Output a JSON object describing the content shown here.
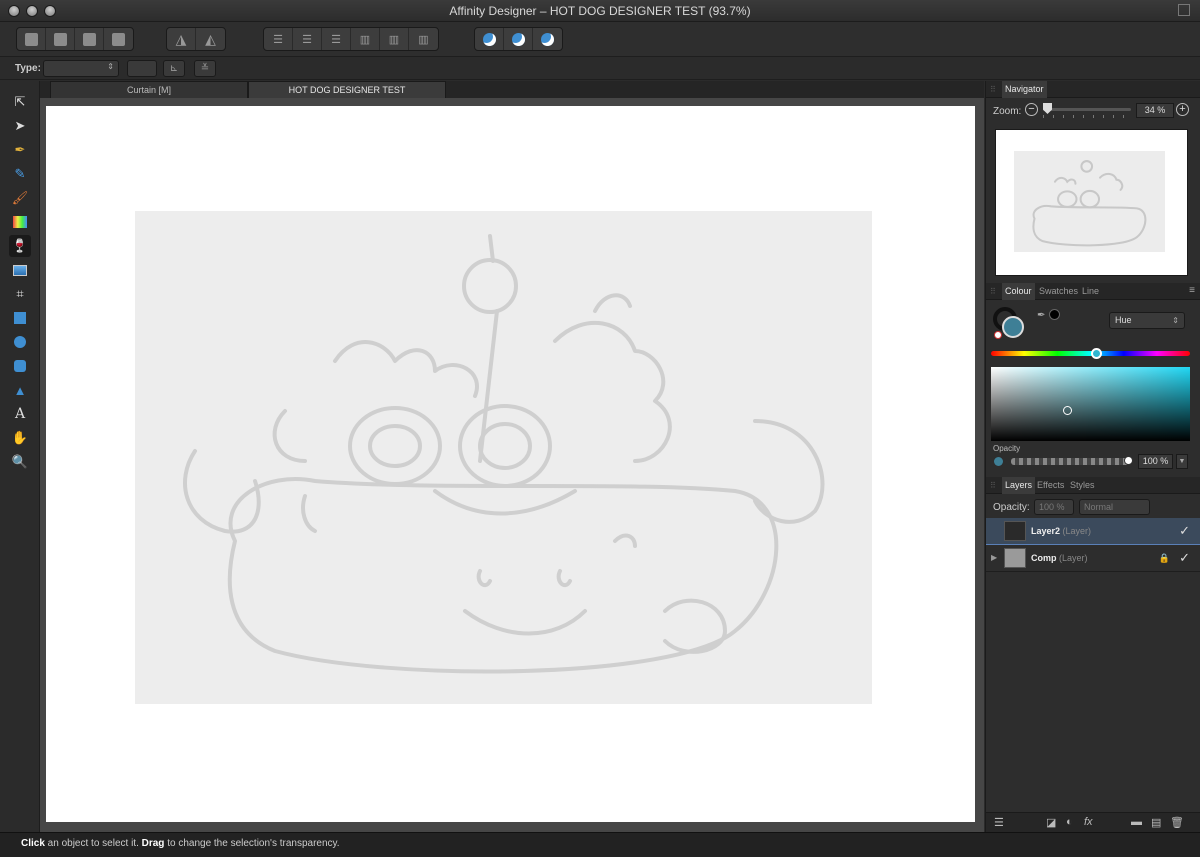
{
  "window": {
    "title": "Affinity Designer – HOT DOG DESIGNER TEST (93.7%)"
  },
  "context_toolbar": {
    "type_label": "Type:"
  },
  "tabs": [
    {
      "label": "Curtain [M]"
    },
    {
      "label": "HOT DOG DESIGNER TEST"
    }
  ],
  "navigator": {
    "tab": "Navigator",
    "zoom_label": "Zoom:",
    "zoom_value": "34 %",
    "zoom_level_percent": 34
  },
  "colour_panel": {
    "tabs": [
      "Colour",
      "Swatches",
      "Line"
    ],
    "fill_color": "#3e7f96",
    "mode": "Hue",
    "opacity_label": "Opacity",
    "opacity_value": "100 %",
    "opacity_percent": 100
  },
  "layers_panel": {
    "tabs": [
      "Layers",
      "Effects",
      "Styles"
    ],
    "opacity_label": "Opacity:",
    "opacity_value": "100 %",
    "blend_mode": "Normal",
    "layers": [
      {
        "name": "Layer2",
        "type": "(Layer)",
        "selected": true,
        "visible": true,
        "locked": false
      },
      {
        "name": "Comp",
        "type": "(Layer)",
        "selected": false,
        "visible": true,
        "locked": true
      }
    ]
  },
  "status": {
    "click": "Click",
    "click_text": " an object to select it. ",
    "drag": "Drag",
    "drag_text": " to change the selection's transparency."
  },
  "tool_icons": [
    "move-tool-icon",
    "node-tool-icon",
    "pen-tool-icon",
    "pencil-tool-icon",
    "brush-tool-icon",
    "fill-tool-icon",
    "transparency-tool-icon",
    "place-image-tool-icon",
    "crop-tool-icon",
    "rectangle-tool-icon",
    "ellipse-tool-icon",
    "rounded-rectangle-tool-icon",
    "triangle-tool-icon",
    "text-tool-icon",
    "hand-tool-icon",
    "zoom-tool-icon"
  ]
}
